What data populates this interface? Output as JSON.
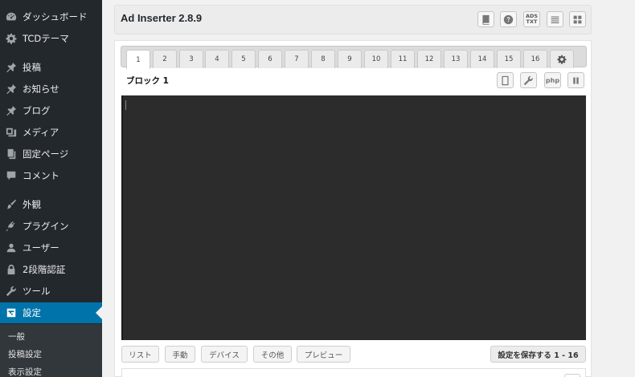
{
  "sidebar": {
    "items": [
      {
        "label": "ダッシュボード",
        "icon": "dashboard-icon"
      },
      {
        "label": "TCDテーマ",
        "icon": "gear-icon"
      },
      {
        "label": "投稿",
        "icon": "pin-icon"
      },
      {
        "label": "お知らせ",
        "icon": "pin-icon"
      },
      {
        "label": "ブログ",
        "icon": "pin-icon"
      },
      {
        "label": "メディア",
        "icon": "media-icon"
      },
      {
        "label": "固定ページ",
        "icon": "page-icon"
      },
      {
        "label": "コメント",
        "icon": "comment-icon"
      },
      {
        "label": "外観",
        "icon": "brush-icon"
      },
      {
        "label": "プラグイン",
        "icon": "plugin-icon"
      },
      {
        "label": "ユーザー",
        "icon": "user-icon"
      },
      {
        "label": "2段階認証",
        "icon": "lock-icon"
      },
      {
        "label": "ツール",
        "icon": "wrench-icon"
      },
      {
        "label": "設定",
        "icon": "settings-icon"
      }
    ],
    "submenu": [
      "一般",
      "投稿設定",
      "表示設定"
    ],
    "active_color": "#0073aa"
  },
  "header": {
    "title": "Ad Inserter 2.8.9",
    "buttons": [
      "book-icon",
      "help-icon",
      "ads-txt-icon",
      "list-icon",
      "grid-icon"
    ],
    "ads_txt_label": "ADS TXT"
  },
  "tabs": [
    "1",
    "2",
    "3",
    "4",
    "5",
    "6",
    "7",
    "8",
    "9",
    "10",
    "11",
    "12",
    "13",
    "14",
    "15",
    "16"
  ],
  "active_tab": "1",
  "block": {
    "title": "ブロック 1",
    "php_label": "php"
  },
  "footer": {
    "list": "リスト",
    "manual": "手動",
    "device": "デバイス",
    "other": "その他",
    "preview": "プレビュー",
    "save": "設定を保存する 1 - 16"
  }
}
